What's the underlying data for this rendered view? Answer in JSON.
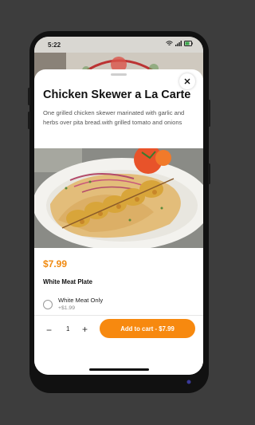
{
  "status": {
    "time": "5:22"
  },
  "item": {
    "title": "Chicken Skewer a La Carte",
    "description": "One grilled chicken skewer  marinated with garlic and herbs over pita bread.with grilled tomato and onions",
    "price": "$7.99"
  },
  "options": {
    "section_title": "White Meat Plate",
    "items": [
      {
        "name": "White Meat Only",
        "price": "+$1.99"
      }
    ]
  },
  "footer": {
    "minus": "−",
    "quantity": "1",
    "plus": "+",
    "cart_label": "Add to cart - $7.99"
  },
  "colors": {
    "accent": "#f7890f",
    "price": "#f08a10"
  },
  "icons": [
    "close-icon",
    "wifi-icon",
    "signal-icon",
    "battery-icon"
  ]
}
